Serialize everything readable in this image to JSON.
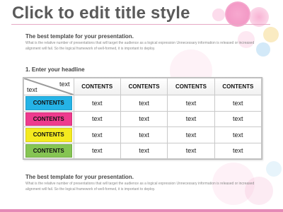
{
  "slide": {
    "title": "Click to edit title style",
    "intro": {
      "heading": "The best template for your presentation.",
      "body": "What is the relative number of presentations that will target the audience as a logical expression Unnecessary information is released or increased alignment will fail. So the logical framework of well-formed, it is important to deploy."
    },
    "headline": "1.    Enter your headline",
    "outro": {
      "heading": "The best template for your presentation.",
      "body": "What is the relative number of presentations that will target the audience as a logical expression Unnecessary information is released or increased alignment will fail. So the logical framework of well-formed, it is important to deploy."
    }
  },
  "table": {
    "corner_top": "text",
    "corner_bottom": "text",
    "columns": [
      "CONTENTS",
      "CONTENTS",
      "CONTENTS",
      "CONTENTS"
    ],
    "rows": [
      {
        "label": "CONTENTS",
        "color": "#25b3e6",
        "cells": [
          "text",
          "text",
          "text",
          "text"
        ]
      },
      {
        "label": "CONTENTS",
        "color": "#ee3b8e",
        "cells": [
          "text",
          "text",
          "text",
          "text"
        ]
      },
      {
        "label": "CONTENTS",
        "color": "#f4ea1f",
        "cells": [
          "text",
          "text",
          "text",
          "text"
        ]
      },
      {
        "label": "CONTENTS",
        "color": "#86c553",
        "cells": [
          "text",
          "text",
          "text",
          "text"
        ]
      }
    ]
  },
  "theme": {
    "accent": "#e58ab7",
    "rule": "#e6a8c4"
  }
}
